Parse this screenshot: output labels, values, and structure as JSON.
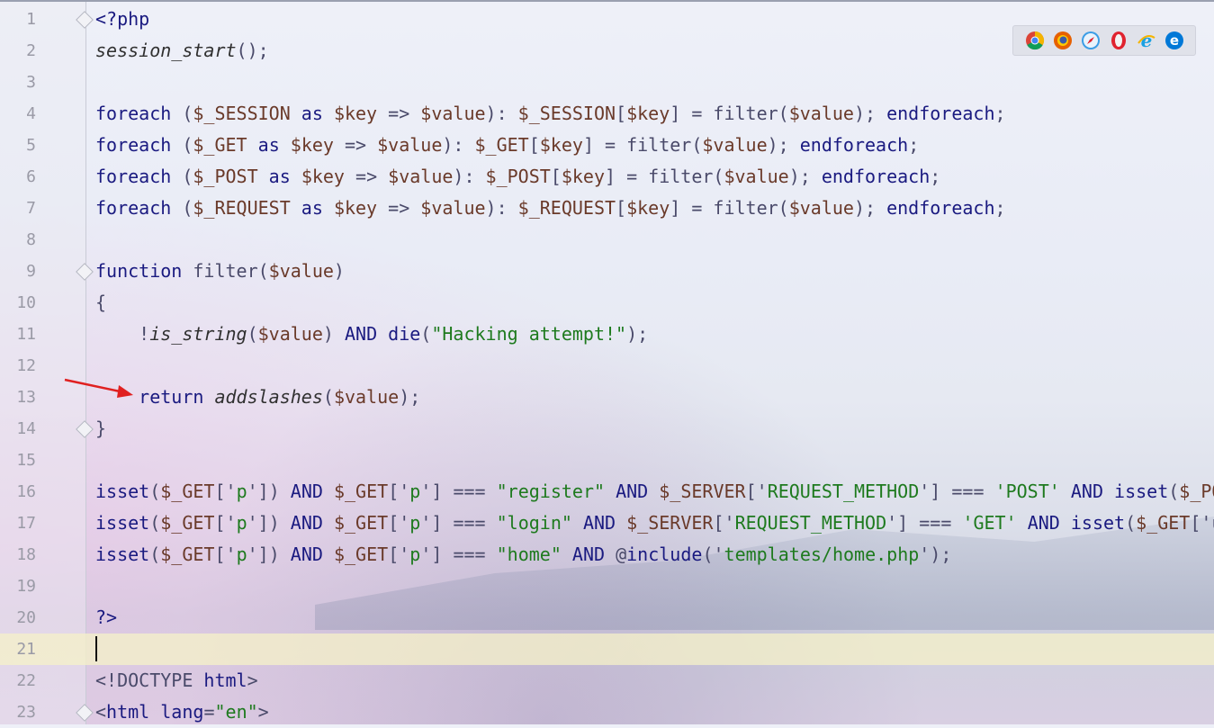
{
  "editor": {
    "current_line": 21,
    "lines": [
      {
        "n": "1",
        "segments": [
          {
            "t": "<?php",
            "c": "kw"
          }
        ]
      },
      {
        "n": "2",
        "segments": [
          {
            "t": "session_start",
            "c": "fn-i"
          },
          {
            "t": "();",
            "c": "op"
          }
        ]
      },
      {
        "n": "3",
        "segments": []
      },
      {
        "n": "4",
        "segments": [
          {
            "t": "foreach",
            "c": "kw"
          },
          {
            "t": " (",
            "c": "op"
          },
          {
            "t": "$_SESSION",
            "c": "var"
          },
          {
            "t": " as ",
            "c": "kw"
          },
          {
            "t": "$key",
            "c": "var"
          },
          {
            "t": " => ",
            "c": "op"
          },
          {
            "t": "$value",
            "c": "var"
          },
          {
            "t": "): ",
            "c": "op"
          },
          {
            "t": "$_SESSION",
            "c": "var"
          },
          {
            "t": "[",
            "c": "op"
          },
          {
            "t": "$key",
            "c": "var"
          },
          {
            "t": "] = filter(",
            "c": "op"
          },
          {
            "t": "$value",
            "c": "var"
          },
          {
            "t": "); ",
            "c": "op"
          },
          {
            "t": "endforeach",
            "c": "kw"
          },
          {
            "t": ";",
            "c": "op"
          }
        ]
      },
      {
        "n": "5",
        "segments": [
          {
            "t": "foreach",
            "c": "kw"
          },
          {
            "t": " (",
            "c": "op"
          },
          {
            "t": "$_GET",
            "c": "var"
          },
          {
            "t": " as ",
            "c": "kw"
          },
          {
            "t": "$key",
            "c": "var"
          },
          {
            "t": " => ",
            "c": "op"
          },
          {
            "t": "$value",
            "c": "var"
          },
          {
            "t": "): ",
            "c": "op"
          },
          {
            "t": "$_GET",
            "c": "var"
          },
          {
            "t": "[",
            "c": "op"
          },
          {
            "t": "$key",
            "c": "var"
          },
          {
            "t": "] = filter(",
            "c": "op"
          },
          {
            "t": "$value",
            "c": "var"
          },
          {
            "t": "); ",
            "c": "op"
          },
          {
            "t": "endforeach",
            "c": "kw"
          },
          {
            "t": ";",
            "c": "op"
          }
        ]
      },
      {
        "n": "6",
        "segments": [
          {
            "t": "foreach",
            "c": "kw"
          },
          {
            "t": " (",
            "c": "op"
          },
          {
            "t": "$_POST",
            "c": "var"
          },
          {
            "t": " as ",
            "c": "kw"
          },
          {
            "t": "$key",
            "c": "var"
          },
          {
            "t": " => ",
            "c": "op"
          },
          {
            "t": "$value",
            "c": "var"
          },
          {
            "t": "): ",
            "c": "op"
          },
          {
            "t": "$_POST",
            "c": "var"
          },
          {
            "t": "[",
            "c": "op"
          },
          {
            "t": "$key",
            "c": "var"
          },
          {
            "t": "] = filter(",
            "c": "op"
          },
          {
            "t": "$value",
            "c": "var"
          },
          {
            "t": "); ",
            "c": "op"
          },
          {
            "t": "endforeach",
            "c": "kw"
          },
          {
            "t": ";",
            "c": "op"
          }
        ]
      },
      {
        "n": "7",
        "segments": [
          {
            "t": "foreach",
            "c": "kw"
          },
          {
            "t": " (",
            "c": "op"
          },
          {
            "t": "$_REQUEST",
            "c": "var"
          },
          {
            "t": " as ",
            "c": "kw"
          },
          {
            "t": "$key",
            "c": "var"
          },
          {
            "t": " => ",
            "c": "op"
          },
          {
            "t": "$value",
            "c": "var"
          },
          {
            "t": "): ",
            "c": "op"
          },
          {
            "t": "$_REQUEST",
            "c": "var"
          },
          {
            "t": "[",
            "c": "op"
          },
          {
            "t": "$key",
            "c": "var"
          },
          {
            "t": "] = filter(",
            "c": "op"
          },
          {
            "t": "$value",
            "c": "var"
          },
          {
            "t": "); ",
            "c": "op"
          },
          {
            "t": "endforeach",
            "c": "kw"
          },
          {
            "t": ";",
            "c": "op"
          }
        ]
      },
      {
        "n": "8",
        "segments": []
      },
      {
        "n": "9",
        "segments": [
          {
            "t": "function",
            "c": "kw"
          },
          {
            "t": " filter(",
            "c": "op"
          },
          {
            "t": "$value",
            "c": "var"
          },
          {
            "t": ")",
            "c": "op"
          }
        ]
      },
      {
        "n": "10",
        "segments": [
          {
            "t": "{",
            "c": "op"
          }
        ]
      },
      {
        "n": "11",
        "segments": [
          {
            "t": "    !",
            "c": "op"
          },
          {
            "t": "is_string",
            "c": "fn-i"
          },
          {
            "t": "(",
            "c": "op"
          },
          {
            "t": "$value",
            "c": "var"
          },
          {
            "t": ") ",
            "c": "op"
          },
          {
            "t": "AND",
            "c": "kw"
          },
          {
            "t": " ",
            "c": "op"
          },
          {
            "t": "die",
            "c": "kw"
          },
          {
            "t": "(",
            "c": "op"
          },
          {
            "t": "\"Hacking attempt!\"",
            "c": "str"
          },
          {
            "t": ");",
            "c": "op"
          }
        ]
      },
      {
        "n": "12",
        "segments": []
      },
      {
        "n": "13",
        "segments": [
          {
            "t": "    ",
            "c": "op"
          },
          {
            "t": "return",
            "c": "kw"
          },
          {
            "t": " ",
            "c": "op"
          },
          {
            "t": "addslashes",
            "c": "fn-i"
          },
          {
            "t": "(",
            "c": "op"
          },
          {
            "t": "$value",
            "c": "var"
          },
          {
            "t": ");",
            "c": "op"
          }
        ]
      },
      {
        "n": "14",
        "segments": [
          {
            "t": "}",
            "c": "op"
          }
        ]
      },
      {
        "n": "15",
        "segments": []
      },
      {
        "n": "16",
        "segments": [
          {
            "t": "isset",
            "c": "kw"
          },
          {
            "t": "(",
            "c": "op"
          },
          {
            "t": "$_GET",
            "c": "var"
          },
          {
            "t": "['",
            "c": "op"
          },
          {
            "t": "p",
            "c": "str"
          },
          {
            "t": "']) ",
            "c": "op"
          },
          {
            "t": "AND",
            "c": "kw"
          },
          {
            "t": " ",
            "c": "op"
          },
          {
            "t": "$_GET",
            "c": "var"
          },
          {
            "t": "['",
            "c": "op"
          },
          {
            "t": "p",
            "c": "str"
          },
          {
            "t": "'] === ",
            "c": "op"
          },
          {
            "t": "\"register\"",
            "c": "str"
          },
          {
            "t": " ",
            "c": "op"
          },
          {
            "t": "AND",
            "c": "kw"
          },
          {
            "t": " ",
            "c": "op"
          },
          {
            "t": "$_SERVER",
            "c": "var"
          },
          {
            "t": "['",
            "c": "op"
          },
          {
            "t": "REQUEST_METHOD",
            "c": "str"
          },
          {
            "t": "'] === ",
            "c": "op"
          },
          {
            "t": "'POST'",
            "c": "str"
          },
          {
            "t": " ",
            "c": "op"
          },
          {
            "t": "AND",
            "c": "kw"
          },
          {
            "t": " ",
            "c": "op"
          },
          {
            "t": "isset",
            "c": "kw"
          },
          {
            "t": "(",
            "c": "op"
          },
          {
            "t": "$_PO",
            "c": "var"
          }
        ]
      },
      {
        "n": "17",
        "segments": [
          {
            "t": "isset",
            "c": "kw"
          },
          {
            "t": "(",
            "c": "op"
          },
          {
            "t": "$_GET",
            "c": "var"
          },
          {
            "t": "['",
            "c": "op"
          },
          {
            "t": "p",
            "c": "str"
          },
          {
            "t": "']) ",
            "c": "op"
          },
          {
            "t": "AND",
            "c": "kw"
          },
          {
            "t": " ",
            "c": "op"
          },
          {
            "t": "$_GET",
            "c": "var"
          },
          {
            "t": "['",
            "c": "op"
          },
          {
            "t": "p",
            "c": "str"
          },
          {
            "t": "'] === ",
            "c": "op"
          },
          {
            "t": "\"login\"",
            "c": "str"
          },
          {
            "t": " ",
            "c": "op"
          },
          {
            "t": "AND",
            "c": "kw"
          },
          {
            "t": " ",
            "c": "op"
          },
          {
            "t": "$_SERVER",
            "c": "var"
          },
          {
            "t": "['",
            "c": "op"
          },
          {
            "t": "REQUEST_METHOD",
            "c": "str"
          },
          {
            "t": "'] === ",
            "c": "op"
          },
          {
            "t": "'GET'",
            "c": "str"
          },
          {
            "t": " ",
            "c": "op"
          },
          {
            "t": "AND",
            "c": "kw"
          },
          {
            "t": " ",
            "c": "op"
          },
          {
            "t": "isset",
            "c": "kw"
          },
          {
            "t": "(",
            "c": "op"
          },
          {
            "t": "$_GET",
            "c": "var"
          },
          {
            "t": "['u",
            "c": "op"
          }
        ]
      },
      {
        "n": "18",
        "segments": [
          {
            "t": "isset",
            "c": "kw"
          },
          {
            "t": "(",
            "c": "op"
          },
          {
            "t": "$_GET",
            "c": "var"
          },
          {
            "t": "['",
            "c": "op"
          },
          {
            "t": "p",
            "c": "str"
          },
          {
            "t": "']) ",
            "c": "op"
          },
          {
            "t": "AND",
            "c": "kw"
          },
          {
            "t": " ",
            "c": "op"
          },
          {
            "t": "$_GET",
            "c": "var"
          },
          {
            "t": "['",
            "c": "op"
          },
          {
            "t": "p",
            "c": "str"
          },
          {
            "t": "'] === ",
            "c": "op"
          },
          {
            "t": "\"home\"",
            "c": "str"
          },
          {
            "t": " ",
            "c": "op"
          },
          {
            "t": "AND",
            "c": "kw"
          },
          {
            "t": " @",
            "c": "op"
          },
          {
            "t": "include",
            "c": "kw"
          },
          {
            "t": "('",
            "c": "op"
          },
          {
            "t": "templates/home.php",
            "c": "str"
          },
          {
            "t": "');",
            "c": "op"
          }
        ]
      },
      {
        "n": "19",
        "segments": []
      },
      {
        "n": "20",
        "segments": [
          {
            "t": "?>",
            "c": "kw"
          }
        ]
      },
      {
        "n": "21",
        "segments": []
      },
      {
        "n": "22",
        "segments": [
          {
            "t": "<!DOCTYPE ",
            "c": "op"
          },
          {
            "t": "html",
            "c": "kw"
          },
          {
            "t": ">",
            "c": "op"
          }
        ]
      },
      {
        "n": "23",
        "segments": [
          {
            "t": "<",
            "c": "op"
          },
          {
            "t": "html",
            "c": "kw"
          },
          {
            "t": " ",
            "c": "op"
          },
          {
            "t": "lang",
            "c": "kw"
          },
          {
            "t": "=",
            "c": "op"
          },
          {
            "t": "\"en\"",
            "c": "str"
          },
          {
            "t": ">",
            "c": "op"
          }
        ]
      }
    ],
    "fold_markers": [
      1,
      9,
      14,
      23
    ]
  },
  "browser_toolbar": {
    "icons": [
      {
        "name": "chrome-icon",
        "color": "#4285f4"
      },
      {
        "name": "firefox-icon",
        "color": "#e66000"
      },
      {
        "name": "safari-icon",
        "color": "#3b9de6"
      },
      {
        "name": "opera-icon",
        "color": "#e0232f"
      },
      {
        "name": "ie-icon",
        "color": "#1ba1e2"
      },
      {
        "name": "edge-icon",
        "color": "#0078d7"
      }
    ]
  },
  "annotation": {
    "arrow_color": "#e02020",
    "points_to_line": 13
  }
}
